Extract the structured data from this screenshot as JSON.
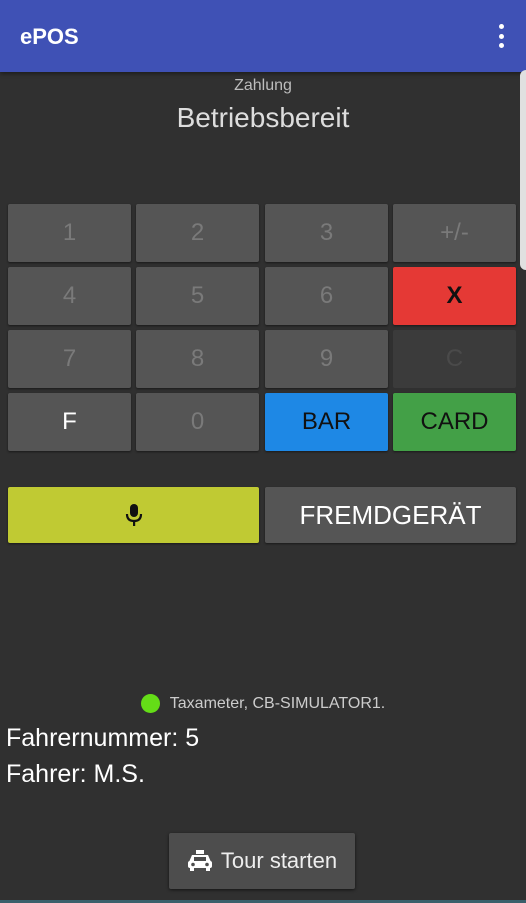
{
  "app": {
    "title": "ePOS"
  },
  "header": {
    "subtitle": "Zahlung",
    "status": "Betriebsbereit"
  },
  "keypad": {
    "k1": "1",
    "k2": "2",
    "k3": "3",
    "sign": "+/-",
    "k4": "4",
    "k5": "5",
    "k6": "6",
    "cancel": "X",
    "k7": "7",
    "k8": "8",
    "k9": "9",
    "clear": "C",
    "f": "F",
    "k0": "0",
    "bar": "BAR",
    "card": "CARD"
  },
  "actions": {
    "microphone_icon": "microphone-icon",
    "external_device": "FREMDGERÄT"
  },
  "device": {
    "status_color": "#64dd17",
    "label": "Taxameter, CB-SIMULATOR1."
  },
  "driver": {
    "number": "Fahrernummer: 5",
    "name": "Fahrer: M.S."
  },
  "tour": {
    "icon": "taxi-icon",
    "label": "Tour starten"
  },
  "colors": {
    "appbar": "#3f51b5",
    "cancel": "#e53935",
    "bar": "#1e88e5",
    "card": "#43a047",
    "mic": "#c0ca33",
    "background": "#303030"
  }
}
